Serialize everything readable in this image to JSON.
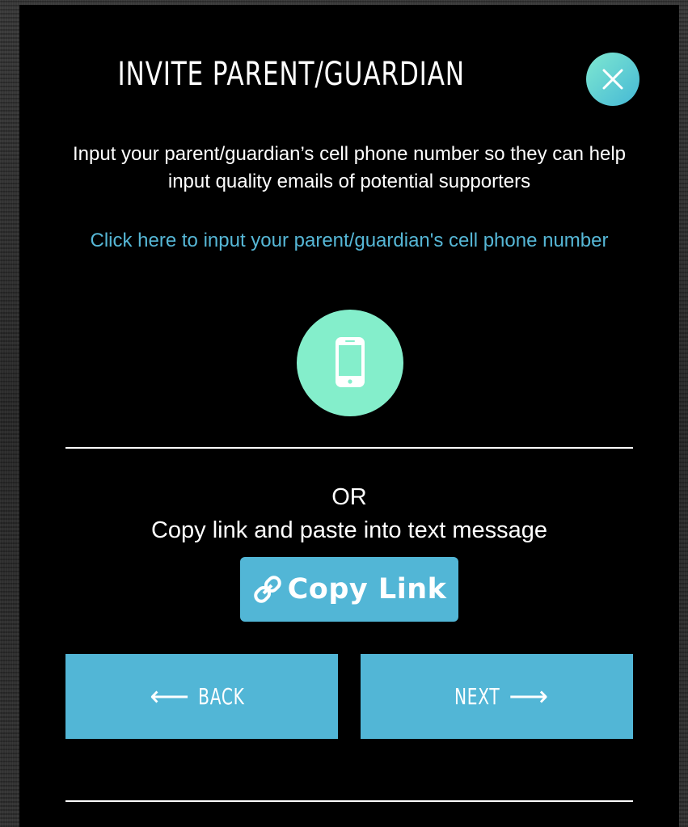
{
  "modal": {
    "title": "INVITE PARENT/GUARDIAN",
    "intro_text": "Input your parent/guardian’s cell phone number so they can help input quality emails of potential supporters",
    "phone_link_text": "Click here to input your parent/guardian's cell phone number",
    "or_text": "OR",
    "copy_instruction": "Copy link and paste into text message",
    "copy_link_label": "Copy Link",
    "back_arrow": "⟵",
    "back_label": "BACK",
    "next_label": "NEXT",
    "next_arrow": "⟶"
  },
  "icons": {
    "close": "close-icon",
    "phone": "smartphone-icon",
    "link": "link-icon"
  },
  "colors": {
    "modal_background": "#000000",
    "accent_blue": "#52b6d6",
    "link_text": "#56b7d6",
    "phone_circle": "#84eecb",
    "close_gradient_start": "#7fe8d0",
    "close_gradient_end": "#45b8d6",
    "text": "#ffffff"
  }
}
